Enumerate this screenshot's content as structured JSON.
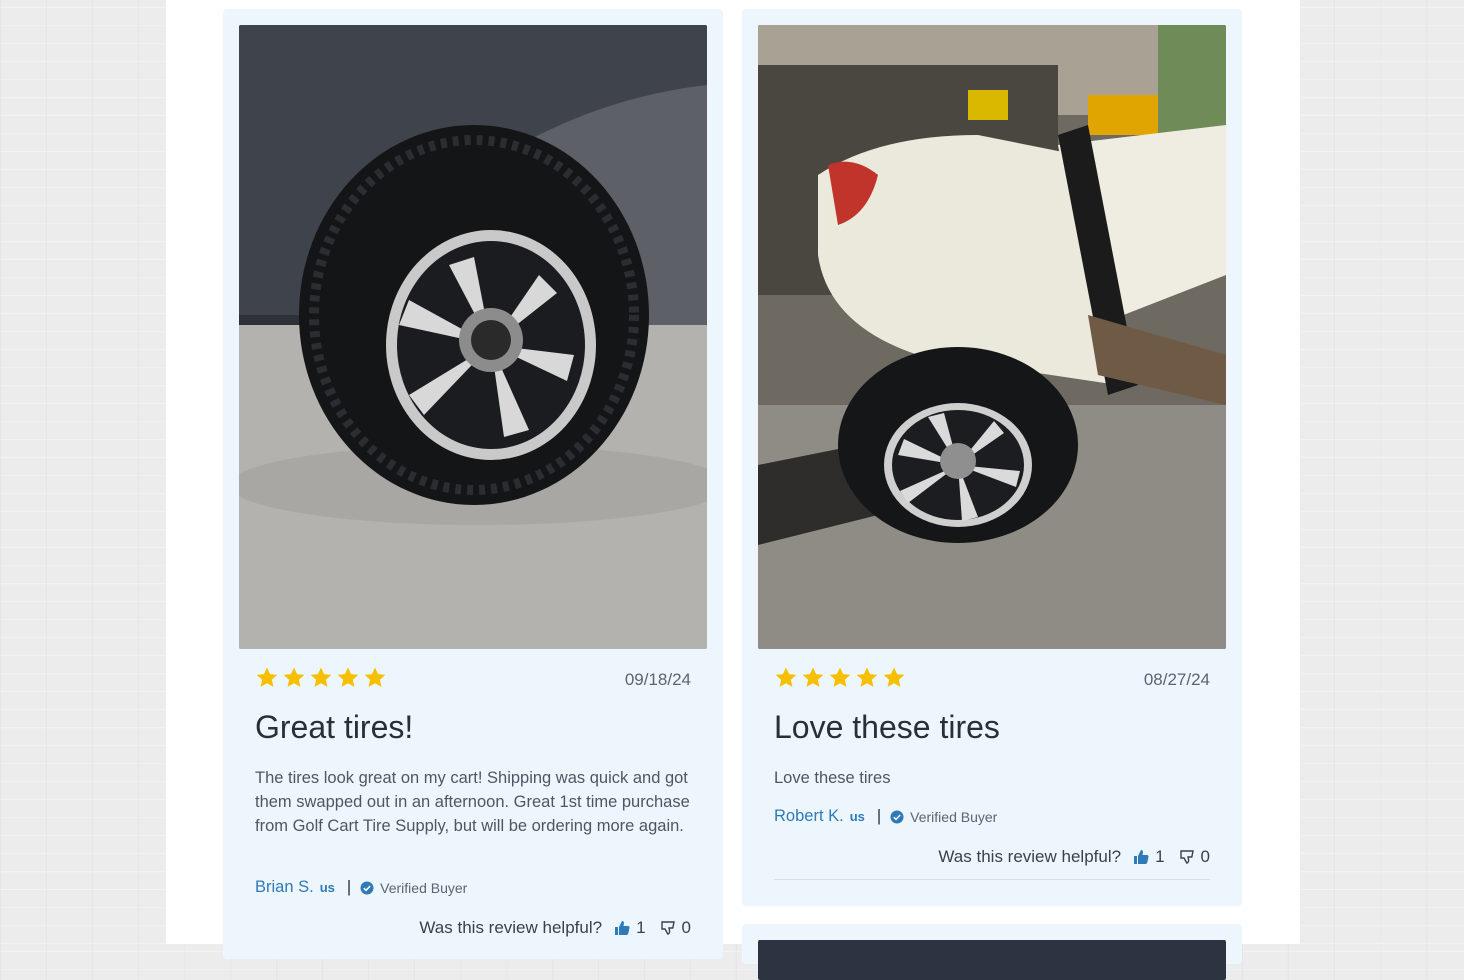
{
  "colors": {
    "star": "#f6c000",
    "link": "#2f7ab8",
    "verified": "#2f7ab8",
    "card_bg": "#eef6fd"
  },
  "reviews": [
    {
      "rating": 5,
      "date": "09/18/24",
      "title": "Great tires!",
      "body": "The tires look great on my cart! Shipping was quick and got them swapped out in an afternoon. Great 1st time purchase from Golf Cart Tire Supply, but will be ordering more again.",
      "author": "Brian S.",
      "country": "us",
      "separator": "|",
      "verified": "Verified Buyer",
      "helpful_question": "Was this review helpful?",
      "helpful_up": "1",
      "helpful_down": "0"
    },
    {
      "rating": 5,
      "date": "08/27/24",
      "title": "Love these tires",
      "body": "Love these tires",
      "author": "Robert K.",
      "country": "us",
      "separator": "|",
      "verified": "Verified Buyer",
      "helpful_question": "Was this review helpful?",
      "helpful_up": "1",
      "helpful_down": "0"
    }
  ]
}
